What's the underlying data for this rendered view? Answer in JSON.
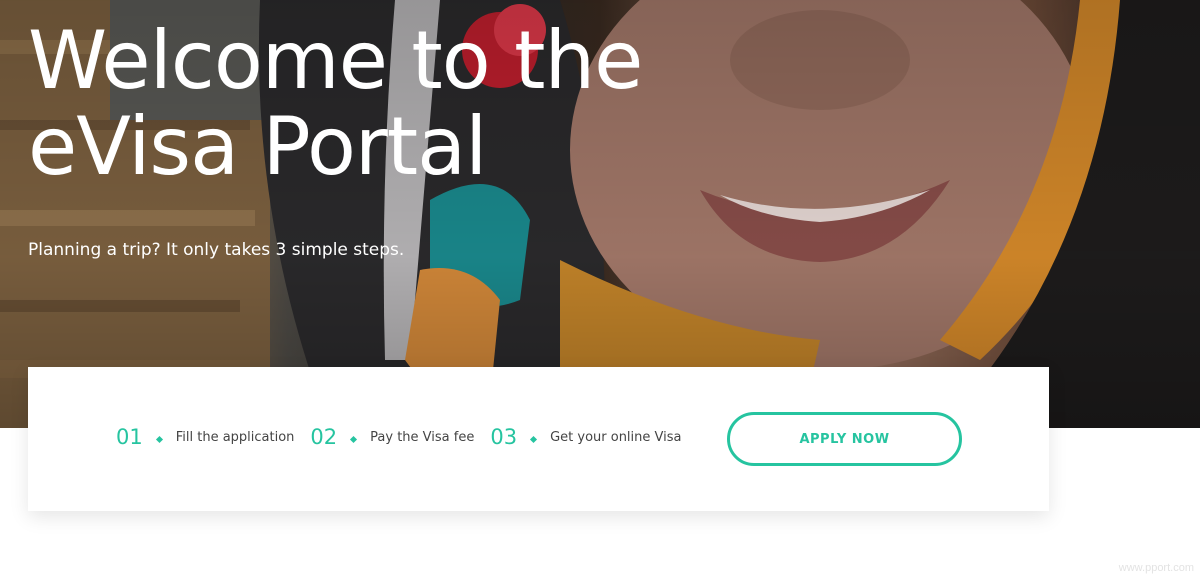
{
  "hero": {
    "title_line1": "Welcome to the",
    "title_line2": "eVisa Portal",
    "subtitle": "Planning a trip? It only takes 3 simple steps."
  },
  "steps": [
    {
      "number": "01",
      "label": "Fill the application"
    },
    {
      "number": "02",
      "label": "Pay the Visa fee"
    },
    {
      "number": "03",
      "label": "Get your online Visa"
    }
  ],
  "apply_button": {
    "label": "APPLY NOW"
  },
  "watermark": {
    "text": "www.pport.com"
  },
  "colors": {
    "accent": "#26c4a0",
    "text": "#444444",
    "hero_text": "#ffffff"
  }
}
